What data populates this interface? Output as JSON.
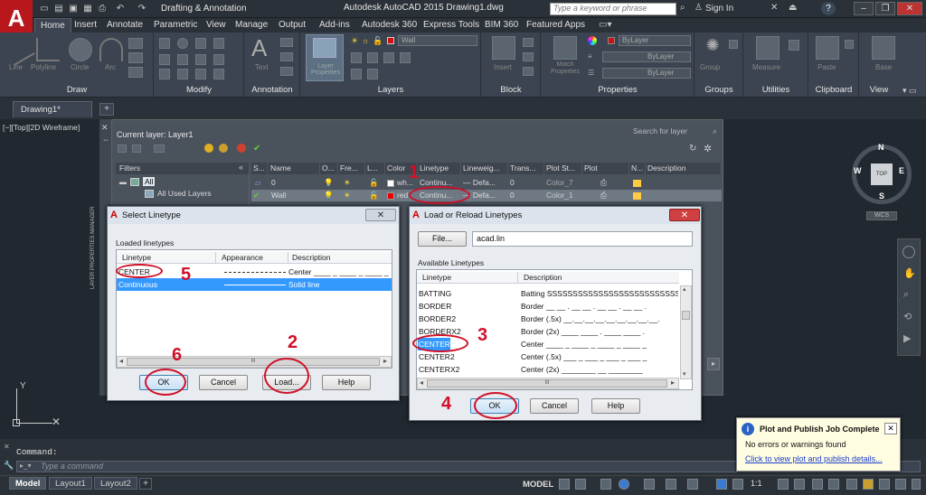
{
  "titlebar": {
    "workspace": "Drafting & Annotation",
    "title": "Autodesk AutoCAD 2015  Drawing1.dwg",
    "search_placeholder": "Type a keyword or phrase",
    "signin": "Sign In",
    "help": "?"
  },
  "ribbon": {
    "tabs": [
      "Home",
      "Insert",
      "Annotate",
      "Parametric",
      "View",
      "Manage",
      "Output",
      "Add-ins",
      "Autodesk 360",
      "Express Tools",
      "BIM 360",
      "Featured Apps"
    ],
    "panels": [
      "Draw",
      "Modify",
      "Annotation",
      "Layers",
      "Block",
      "Properties",
      "Groups",
      "Utilities",
      "Clipboard",
      "View"
    ],
    "draw_tools": [
      "Line",
      "Polyline",
      "Circle",
      "Arc"
    ],
    "text_tool": "Text",
    "layer_props": "Layer Properties",
    "insert": "Insert",
    "match_props": "Match Properties",
    "group": "Group",
    "measure": "Measure",
    "paste": "Paste",
    "base": "Base",
    "layer_combo": "Wall",
    "bylayer_color": "ByLayer",
    "bylayer_lt": "ByLayer",
    "bylayer_lw": "ByLayer"
  },
  "doc": {
    "tab": "Drawing1*",
    "new": "+"
  },
  "viewport": {
    "label": "[−][Top][2D Wireframe]"
  },
  "viewcube": {
    "n": "N",
    "s": "S",
    "e": "E",
    "w": "W",
    "top": "TOP",
    "wcs": "WCS"
  },
  "ucs": {
    "y": "Y"
  },
  "lpm": {
    "side_label": "LAYER PROPERTIES MANAGER",
    "current": "Current layer: Layer1",
    "search": "Search for layer",
    "headers": [
      "S...",
      "Name",
      "O...",
      "Fre...",
      "L...",
      "Color",
      "Linetype",
      "Lineweig...",
      "Trans...",
      "Plot St...",
      "Plot",
      "N...",
      "Description"
    ],
    "filters_title": "Filters",
    "filter_all": "All",
    "filter_used": "All Used Layers",
    "rows": [
      {
        "name": "0",
        "color": "wh...",
        "linetype": "Continu...",
        "lineweight": "— Defa...",
        "trans": "0",
        "plotstyle": "Color_7"
      },
      {
        "name": "Wall",
        "color": "red",
        "linetype": "Continu...",
        "lineweight": "— Defa...",
        "trans": "0",
        "plotstyle": "Color_1"
      }
    ]
  },
  "select_lt": {
    "title": "Select Linetype",
    "loaded_label": "Loaded linetypes",
    "headers": [
      "Linetype",
      "Appearance",
      "Description"
    ],
    "rows": [
      {
        "name": "CENTER",
        "desc": "Center ____ _ ____ _ ____ _"
      },
      {
        "name": "Continuous",
        "desc": "Solid line"
      }
    ],
    "ok": "OK",
    "cancel": "Cancel",
    "load": "Load...",
    "help": "Help",
    "scroll_mid": "III"
  },
  "load_lt": {
    "title": "Load or Reload Linetypes",
    "file_btn": "File...",
    "file_value": "acad.lin",
    "avail_label": "Available Linetypes",
    "headers": [
      "Linetype",
      "Description"
    ],
    "rows": [
      {
        "name": "BATTING",
        "desc": "Batting SSSSSSSSSSSSSSSSSSSSSSSSSSSSSS"
      },
      {
        "name": "BORDER",
        "desc": "Border __ __ . __ __ . __ __ . __ __ ."
      },
      {
        "name": "BORDER2",
        "desc": "Border (.5x) __.__.__.__.__.__.__.__.__."
      },
      {
        "name": "BORDERX2",
        "desc": "Border (2x) ____ ____ . ____ ____ ."
      },
      {
        "name": "CENTER",
        "desc": "Center ____ _ ____ _ ____ _ ____ _"
      },
      {
        "name": "CENTER2",
        "desc": "Center (.5x) ___ _ ___ _ ___ _ ___ _"
      },
      {
        "name": "CENTERX2",
        "desc": "Center (2x) ________  __  ________"
      }
    ],
    "ok": "OK",
    "cancel": "Cancel",
    "help": "Help",
    "scroll_mid": "III"
  },
  "annotations": [
    "1",
    "2",
    "3",
    "4",
    "5",
    "6"
  ],
  "command": {
    "label": "Command:",
    "placeholder": "Type a command"
  },
  "layouts": [
    "Model",
    "Layout1",
    "Layout2"
  ],
  "status": {
    "model": "MODEL",
    "scale": "1:1"
  },
  "notification": {
    "title": "Plot and Publish Job Complete",
    "body": "No errors or warnings found",
    "link": "Click to view plot and publish details..."
  }
}
